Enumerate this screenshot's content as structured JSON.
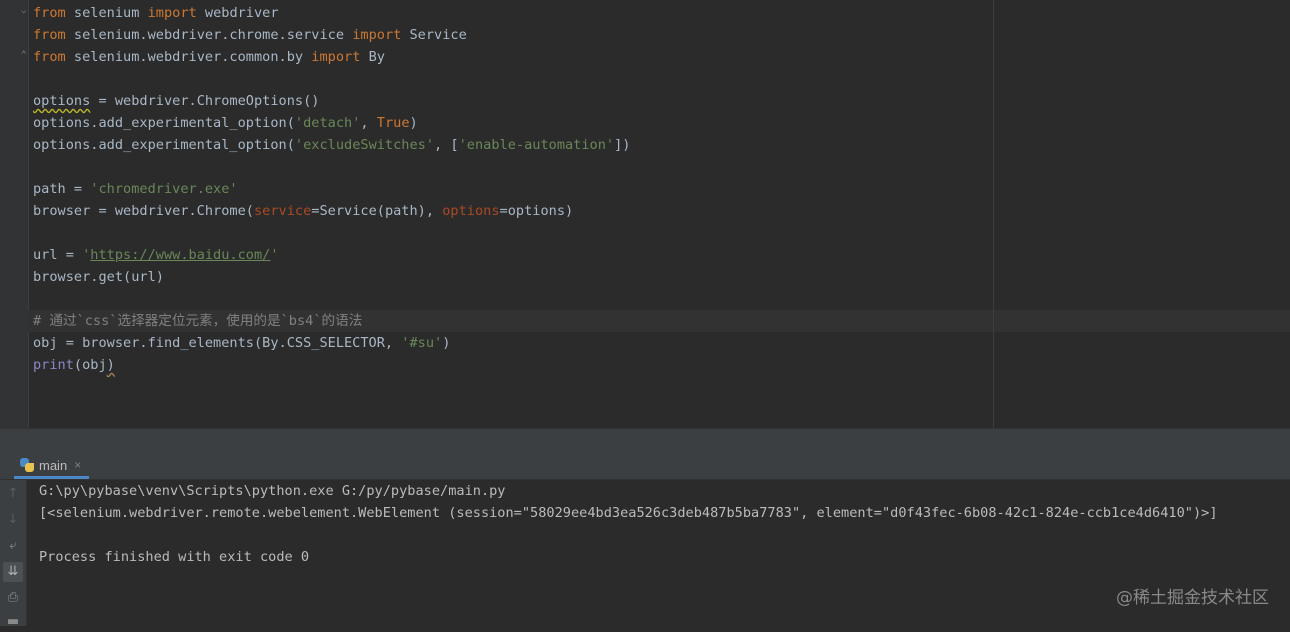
{
  "editor": {
    "lines": [
      {
        "segments": [
          {
            "t": "from",
            "c": "kw"
          },
          {
            "t": " selenium ",
            "c": ""
          },
          {
            "t": "import",
            "c": "kw"
          },
          {
            "t": " webdriver",
            "c": ""
          }
        ]
      },
      {
        "segments": [
          {
            "t": "from",
            "c": "kw"
          },
          {
            "t": " selenium.webdriver.chrome.service ",
            "c": ""
          },
          {
            "t": "import",
            "c": "kw"
          },
          {
            "t": " Service",
            "c": ""
          }
        ]
      },
      {
        "segments": [
          {
            "t": "from",
            "c": "kw"
          },
          {
            "t": " selenium.webdriver.common.by ",
            "c": ""
          },
          {
            "t": "import",
            "c": "kw"
          },
          {
            "t": " By",
            "c": ""
          }
        ]
      },
      {
        "segments": []
      },
      {
        "segments": [
          {
            "t": "options",
            "c": "squiggle"
          },
          {
            "t": " = webdriver.ChromeOptions()",
            "c": ""
          }
        ]
      },
      {
        "segments": [
          {
            "t": "options.add_experimental_option(",
            "c": ""
          },
          {
            "t": "'detach'",
            "c": "str"
          },
          {
            "t": ", ",
            "c": ""
          },
          {
            "t": "True",
            "c": "lit"
          },
          {
            "t": ")",
            "c": ""
          }
        ]
      },
      {
        "segments": [
          {
            "t": "options.add_experimental_option(",
            "c": ""
          },
          {
            "t": "'excludeSwitches'",
            "c": "str"
          },
          {
            "t": ", [",
            "c": ""
          },
          {
            "t": "'enable-automation'",
            "c": "str"
          },
          {
            "t": "])",
            "c": ""
          }
        ]
      },
      {
        "segments": []
      },
      {
        "segments": [
          {
            "t": "path = ",
            "c": ""
          },
          {
            "t": "'chromedriver.exe'",
            "c": "str"
          }
        ]
      },
      {
        "segments": [
          {
            "t": "browser = webdriver.Chrome(",
            "c": ""
          },
          {
            "t": "service",
            "c": "param"
          },
          {
            "t": "=Service(path), ",
            "c": ""
          },
          {
            "t": "options",
            "c": "param"
          },
          {
            "t": "=options)",
            "c": ""
          }
        ]
      },
      {
        "segments": []
      },
      {
        "segments": [
          {
            "t": "url = ",
            "c": ""
          },
          {
            "t": "'",
            "c": "str"
          },
          {
            "t": "https://www.baidu.com/",
            "c": "url"
          },
          {
            "t": "'",
            "c": "str"
          }
        ]
      },
      {
        "segments": [
          {
            "t": "browser.get(url)",
            "c": ""
          }
        ]
      },
      {
        "segments": []
      },
      {
        "segments": [
          {
            "t": "# 通过`css`选择器定位元素，使用的是`bs4`的语法",
            "c": "cmt"
          }
        ]
      },
      {
        "segments": [
          {
            "t": "obj = browser.find_elements(By.CSS_SELECTOR, ",
            "c": ""
          },
          {
            "t": "'#su'",
            "c": "str"
          },
          {
            "t": ")",
            "c": ""
          }
        ]
      },
      {
        "segments": [
          {
            "t": "print",
            "c": "builtin"
          },
          {
            "t": "(obj",
            "c": ""
          },
          {
            "t": ")",
            "c": "squiggle-red"
          }
        ]
      }
    ]
  },
  "run_panel": {
    "tab_label": "main",
    "tab_close": "×",
    "console_lines": [
      "G:\\py\\pybase\\venv\\Scripts\\python.exe G:/py/pybase/main.py",
      "[<selenium.webdriver.remote.webelement.WebElement (session=\"58029ee4bd3ea526c3deb487b5ba7783\", element=\"d0f43fec-6b08-42c1-824e-ccb1ce4d6410\")>]",
      "",
      "Process finished with exit code 0"
    ],
    "toolbar_icons": [
      "arrow-up-icon",
      "arrow-down-icon",
      "soft-wrap-icon",
      "scroll-to-end-icon",
      "print-icon",
      "trash-icon"
    ]
  },
  "watermark": "@稀土掘金技术社区",
  "colors": {
    "background": "#2b2b2b",
    "keyword": "#cc7832",
    "string": "#6a8759",
    "parameter": "#aa4926",
    "comment": "#808080",
    "builtin": "#8888c6",
    "default": "#a9b7c6"
  }
}
